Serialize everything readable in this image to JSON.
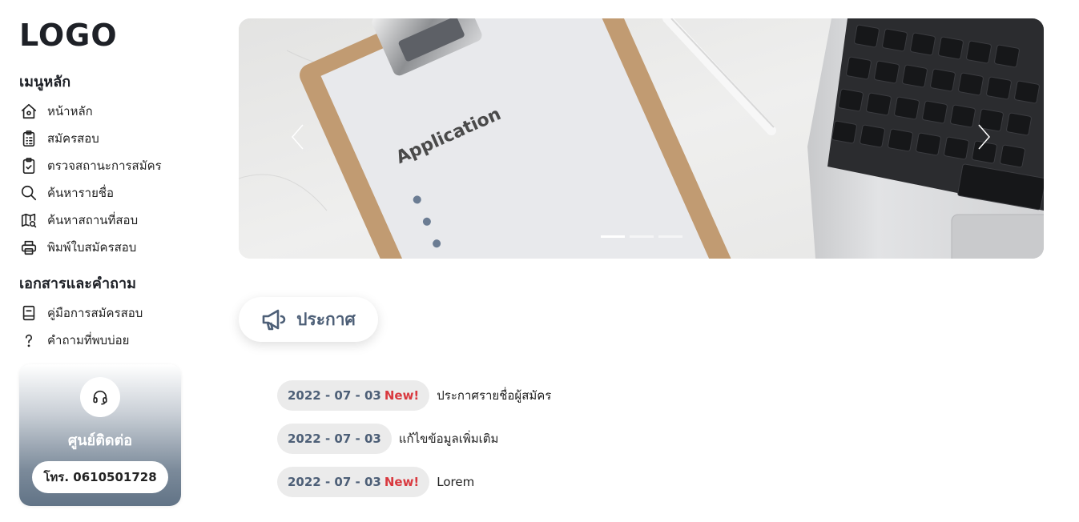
{
  "logo": "LOGO",
  "main_menu": {
    "title": "เมนูหลัก",
    "items": [
      {
        "label": "หน้าหลัก",
        "icon": "home-icon"
      },
      {
        "label": "สมัครสอบ",
        "icon": "clipboard-list-icon"
      },
      {
        "label": "ตรวจสถานะการสมัคร",
        "icon": "clipboard-check-icon"
      },
      {
        "label": "ค้นหารายชื่อ",
        "icon": "search-icon"
      },
      {
        "label": "ค้นหาสถานที่สอบ",
        "icon": "map-search-icon"
      },
      {
        "label": "พิมพ์ใบสมัครสอบ",
        "icon": "printer-icon"
      }
    ]
  },
  "docs_menu": {
    "title": "เอกสารและคำถาม",
    "items": [
      {
        "label": "คู่มือการสมัครสอบ",
        "icon": "book-icon"
      },
      {
        "label": "คำถามที่พบบ่อย",
        "icon": "question-icon"
      }
    ]
  },
  "contact": {
    "icon": "headset-icon",
    "title": "ศูนย์ติดต่อ",
    "phone": "โทร. 0610501728"
  },
  "banner": {
    "image_text": "Application",
    "slide_count": 3,
    "active_slide": 1
  },
  "announcements": {
    "title": "ประกาศ",
    "icon": "megaphone-icon",
    "items": [
      {
        "date": "2022 - 07 - 03",
        "new_label": "New!",
        "title": "ประกาศรายชื่อผู้สมัคร"
      },
      {
        "date": "2022 - 07 - 03",
        "new_label": "",
        "title": "แก้ไขข้อมูลเพิ่มเติม"
      },
      {
        "date": "2022 - 07 - 03",
        "new_label": "New!",
        "title": "Lorem"
      }
    ]
  },
  "colors": {
    "accent": "#4d5f77",
    "new_badge": "#d9393f",
    "badge_bg": "#ebebeb"
  }
}
